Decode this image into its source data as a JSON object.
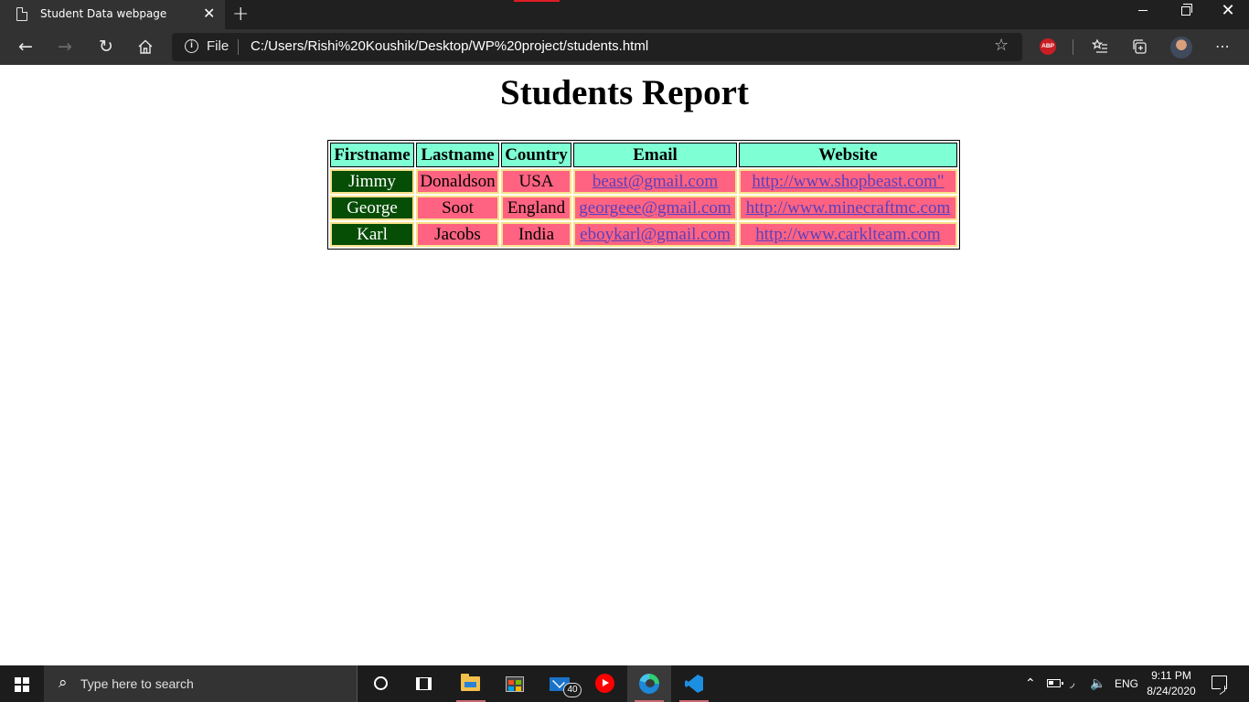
{
  "browser": {
    "tab_title": "Student Data webpage",
    "tab_close": "✕",
    "new_tab": "+",
    "window_close": "✕",
    "address": {
      "scheme": "File",
      "url": "C:/Users/Rishi%20Koushik/Desktop/WP%20project/students.html"
    },
    "abp_label": "ABP",
    "toolbar_icons": [
      "back-icon",
      "forward-icon",
      "refresh-icon",
      "home-icon",
      "info-icon",
      "favorite-star-icon",
      "adblock-icon",
      "favorites-icon",
      "collections-icon",
      "profile-avatar",
      "more-icon"
    ]
  },
  "page": {
    "title": "Students Report",
    "table": {
      "headers": [
        "Firstname",
        "Lastname",
        "Country",
        "Email",
        "Website"
      ],
      "rows": [
        [
          "Jimmy",
          "Donaldson",
          "USA",
          "beast@gmail.com",
          "http://www.shopbeast.com\""
        ],
        [
          "George",
          "Soot",
          "England",
          "georgeee@gmail.com",
          "http://www.minecraftmc.com"
        ],
        [
          "Karl",
          "Jacobs",
          "India",
          "eboykarl@gmail.com",
          "http://www.carklteam.com"
        ]
      ],
      "colors": {
        "header_bg": "#7fffd4",
        "cell_bg": "#ff6381",
        "firstname_bg": "#064d06",
        "cell_border": "#f7e08a",
        "link": "#5c3fbd"
      }
    }
  },
  "taskbar": {
    "search_placeholder": "Type here to search",
    "mail_badge": "40",
    "language": "ENG",
    "time": "9:11 PM",
    "date": "8/24/2020",
    "apps": [
      "cortana-icon",
      "task-view-icon",
      "file-explorer-icon",
      "store-icon",
      "mail-icon",
      "youtube-music-icon",
      "edge-icon",
      "vscode-icon"
    ]
  }
}
